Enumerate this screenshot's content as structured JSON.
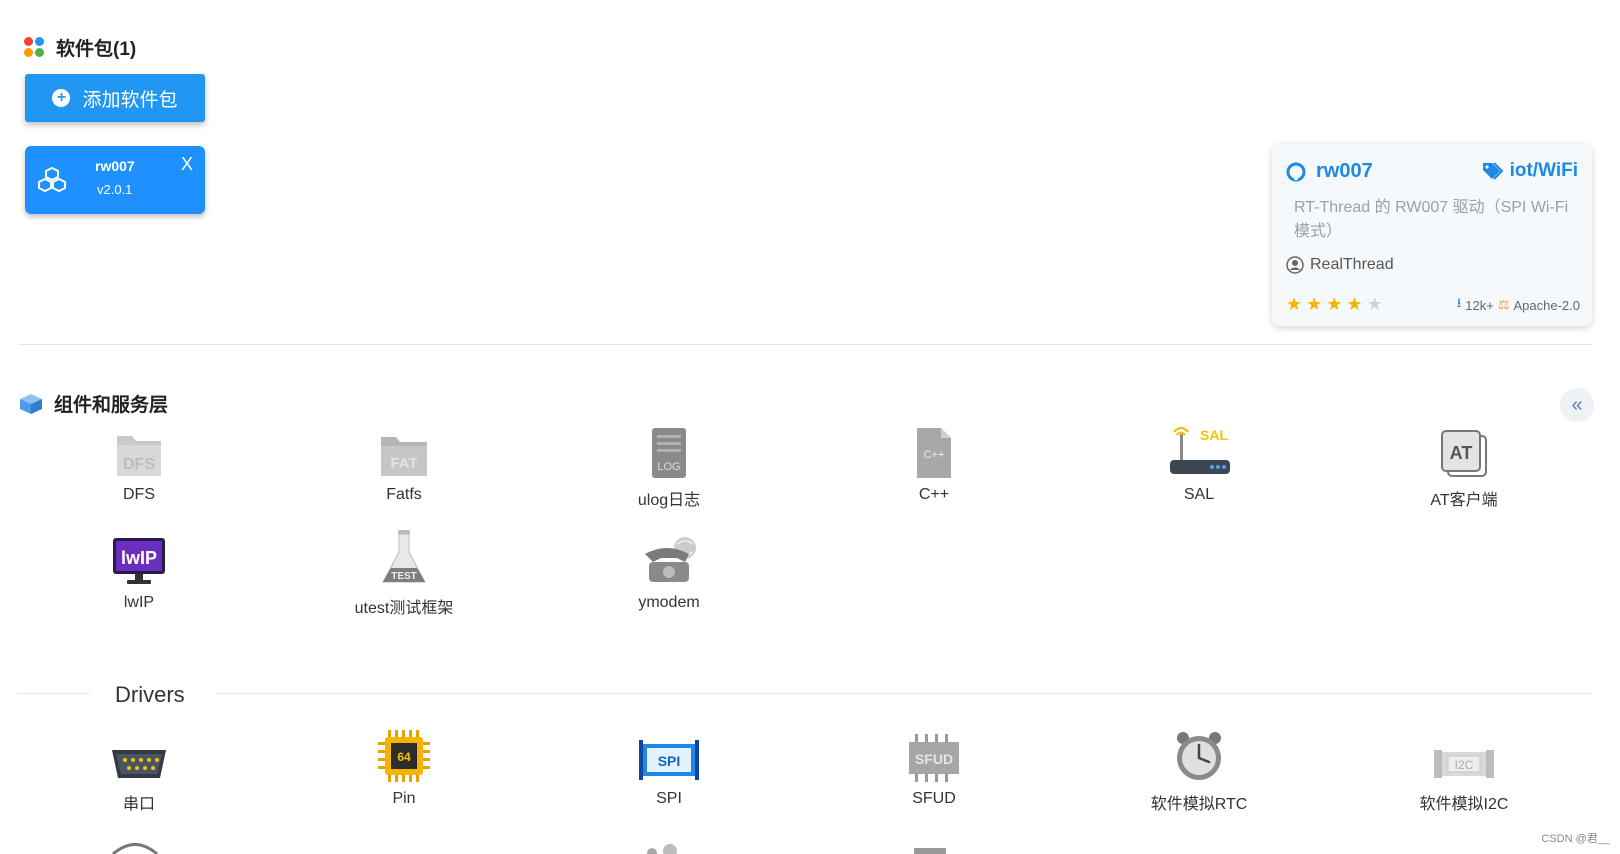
{
  "packages": {
    "title": "软件包(1)",
    "add_button": "添加软件包",
    "selected": {
      "name": "rw007",
      "version": "v2.0.1",
      "close": "X"
    }
  },
  "detail": {
    "repo": "rw007",
    "tag": "iot/WiFi",
    "description": "RT-Thread 的 RW007 驱动（SPI Wi-Fi 模式）",
    "author": "RealThread",
    "rating": 4,
    "downloads": "12k+",
    "license": "Apache-2.0"
  },
  "components": {
    "title": "组件和服务层",
    "collapse": "«",
    "items": [
      "DFS",
      "Fatfs",
      "ulog日志",
      "C++",
      "SAL",
      "AT客户端",
      "lwIP",
      "utest测试框架",
      "ymodem"
    ]
  },
  "drivers": {
    "title": "Drivers",
    "items": [
      "串口",
      "Pin",
      "SPI",
      "SFUD",
      "软件模拟RTC",
      "软件模拟I2C"
    ]
  },
  "watermark": "CSDN @君__",
  "colors": {
    "primary": "#2196f3",
    "link": "#1e88e5",
    "star": "#f5b400"
  }
}
